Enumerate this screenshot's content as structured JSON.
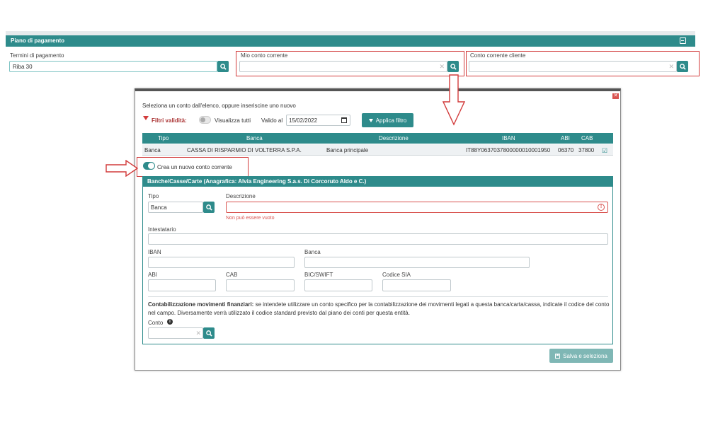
{
  "panel": {
    "title": "Piano di pagamento"
  },
  "fields": {
    "termini_label": "Termini di pagamento",
    "termini_value": "Riba 30",
    "mio_conto_label": "Mio conto corrente",
    "conto_cliente_label": "Conto corrente cliente"
  },
  "modal": {
    "instruction": "Seleziona un conto dall'elenco, oppure inseriscine uno nuovo",
    "filter_label": "Filtri validità:",
    "visualizza_tutti": "Visualizza tutti",
    "valido_al_label": "Valido al",
    "valido_al_value": "15/02/2022",
    "apply_filter": "Applica filtro",
    "table": {
      "headers": [
        "Tipo",
        "Banca",
        "Descrizione",
        "IBAN",
        "ABI",
        "CAB"
      ],
      "rows": [
        {
          "tipo": "Banca",
          "banca": "CASSA DI RISPARMIO DI VOLTERRA S.P.A.",
          "descrizione": "Banca principale",
          "iban": "IT88Y0637037800000010001950",
          "abi": "06370",
          "cab": "37800"
        }
      ]
    },
    "create_new": "Crea un nuovo conto corrente",
    "section_title": "Banche/Casse/Carte (Anagrafica: Alvia Engineering S.a.s. Di Corcoruto Aldo e C.)",
    "form": {
      "tipo_label": "Tipo",
      "tipo_value": "Banca",
      "descrizione_label": "Descrizione",
      "descrizione_error": "Non può essere vuoto",
      "intestatario_label": "Intestatario",
      "iban_label": "IBAN",
      "banca_label": "Banca",
      "abi_label": "ABI",
      "cab_label": "CAB",
      "bic_label": "BIC/SWIFT",
      "sia_label": "Codice SIA",
      "contab_bold": "Contabilizzazione movimenti finanziari:",
      "contab_text": " se intendete utilizzare un conto specifico per la contabilizzazione dei movimenti legati a questa banca/carta/cassa, indicate il codice del conto nel campo. Diversamente verrà utilizzato il codice standard previsto dal piano dei conti per questa entità.",
      "conto_label": "Conto"
    },
    "save_button": "Salva e seleziona"
  },
  "colors": {
    "accent": "#2e8b8b",
    "annotation": "#d23b3b",
    "error": "#d9534f"
  }
}
